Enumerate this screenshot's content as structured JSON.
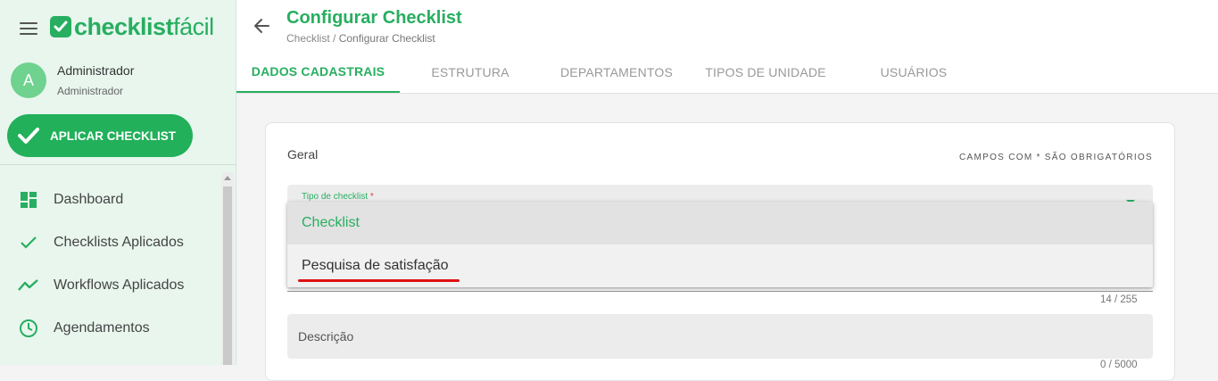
{
  "brand": {
    "logo_bold": "checklist",
    "logo_light": "fácil"
  },
  "user": {
    "initial": "A",
    "name": "Administrador",
    "role": "Administrador"
  },
  "apply_button": {
    "label": "APLICAR CHECKLIST"
  },
  "nav": {
    "items": [
      {
        "label": "Dashboard",
        "icon": "dashboard-icon"
      },
      {
        "label": "Checklists Aplicados",
        "icon": "check-icon"
      },
      {
        "label": "Workflows Aplicados",
        "icon": "trending-icon"
      },
      {
        "label": "Agendamentos",
        "icon": "clock-icon"
      }
    ]
  },
  "header": {
    "title": "Configurar Checklist",
    "breadcrumb_root": "Checklist",
    "breadcrumb_sep": " / ",
    "breadcrumb_current": "Configurar Checklist"
  },
  "tabs": [
    {
      "label": "DADOS CADASTRAIS",
      "active": true
    },
    {
      "label": "ESTRUTURA",
      "active": false
    },
    {
      "label": "DEPARTAMENTOS",
      "active": false
    },
    {
      "label": "TIPOS DE UNIDADE",
      "active": false
    },
    {
      "label": "USUÁRIOS",
      "active": false
    }
  ],
  "form": {
    "section_title": "Geral",
    "required_note": "CAMPOS COM * SÃO OBRIGATÓRIOS",
    "type_field": {
      "label": "Tipo de checklist",
      "required_mark": "*",
      "options": [
        "Checklist",
        "Pesquisa de satisfação"
      ],
      "selected": "Checklist"
    },
    "name_counter": "14 / 255",
    "description_label": "Descrição",
    "description_counter": "0 / 5000"
  },
  "colors": {
    "accent": "#27ae60",
    "sidebar_bg": "#e8f6ee",
    "highlight_underline": "#e01010"
  }
}
